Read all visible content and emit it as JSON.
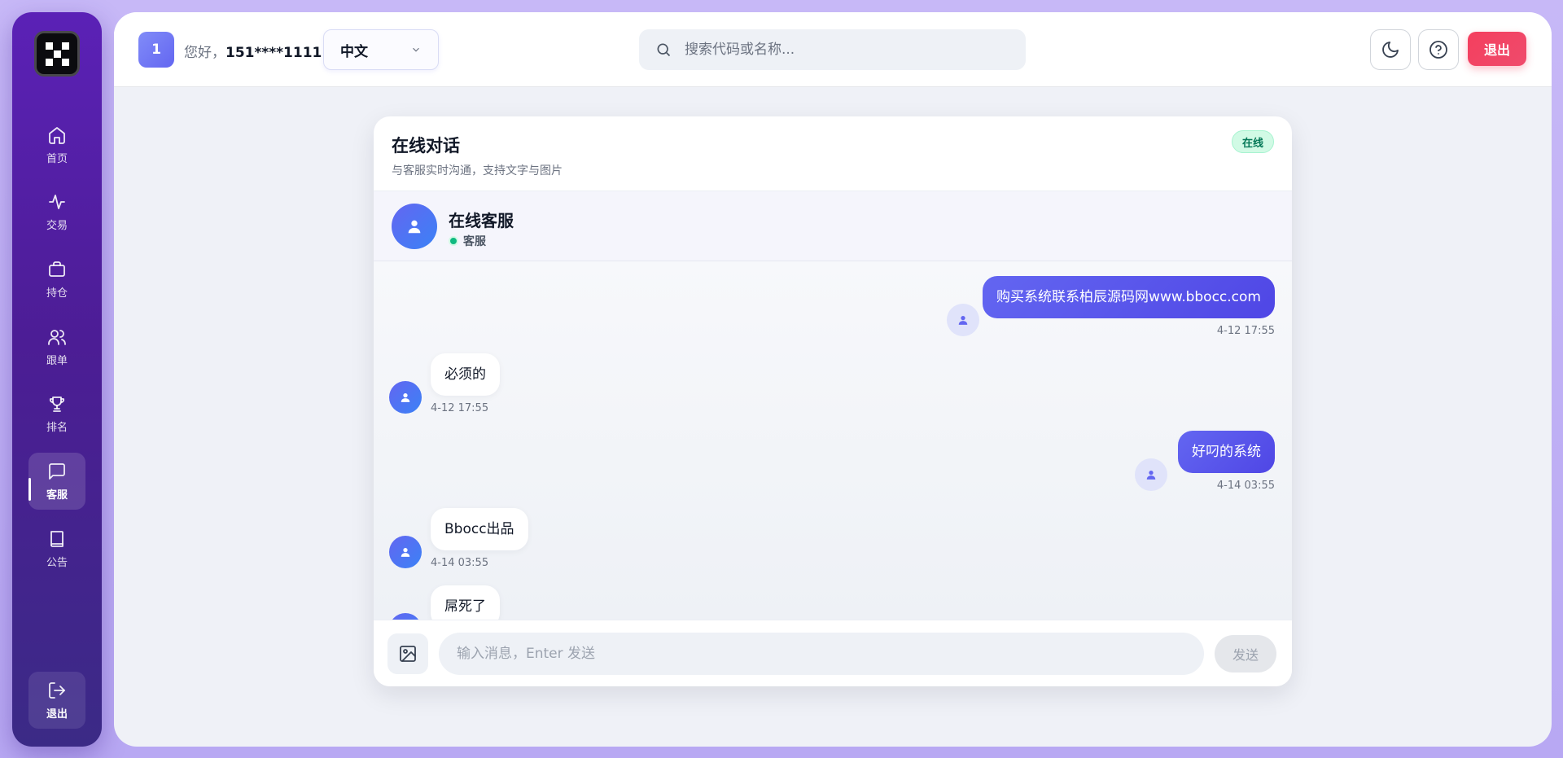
{
  "sidebar": {
    "items": [
      {
        "label": "首页",
        "icon": "home-icon"
      },
      {
        "label": "交易",
        "icon": "activity-icon"
      },
      {
        "label": "持仓",
        "icon": "briefcase-icon"
      },
      {
        "label": "跟单",
        "icon": "users-icon"
      },
      {
        "label": "排名",
        "icon": "trophy-icon"
      },
      {
        "label": "客服",
        "icon": "message-square-icon",
        "active": true
      },
      {
        "label": "公告",
        "icon": "book-icon"
      }
    ],
    "logout_label": "退出"
  },
  "header": {
    "user_number": "1",
    "greeting": "您好，",
    "username": "151****1111",
    "language": "中文",
    "search_placeholder": "搜索代码或名称...",
    "logout_label": "退出"
  },
  "chat": {
    "title": "在线对话",
    "subtitle": "与客服实时沟通，支持文字与图片",
    "status_badge": "在线",
    "agent_name": "在线客服",
    "agent_role": "客服",
    "messages": [
      {
        "direction": "out",
        "text": "购买系统联系柏辰源码网www.bbocc.com",
        "time": "4-12 17:55"
      },
      {
        "direction": "in",
        "text": "必须的",
        "time": "4-12 17:55"
      },
      {
        "direction": "out",
        "text": "好叼的系统",
        "time": "4-14 03:55"
      },
      {
        "direction": "in",
        "text": "Bbocc出品",
        "time": "4-14 03:55"
      },
      {
        "direction": "in",
        "text": "屌死了",
        "time": ""
      }
    ],
    "input_placeholder": "输入消息，Enter 发送",
    "send_label": "发送"
  },
  "colors": {
    "accent": "#6366f1",
    "danger": "#f43f5e",
    "online": "#10b981",
    "sidebar": "#4c1d95"
  }
}
